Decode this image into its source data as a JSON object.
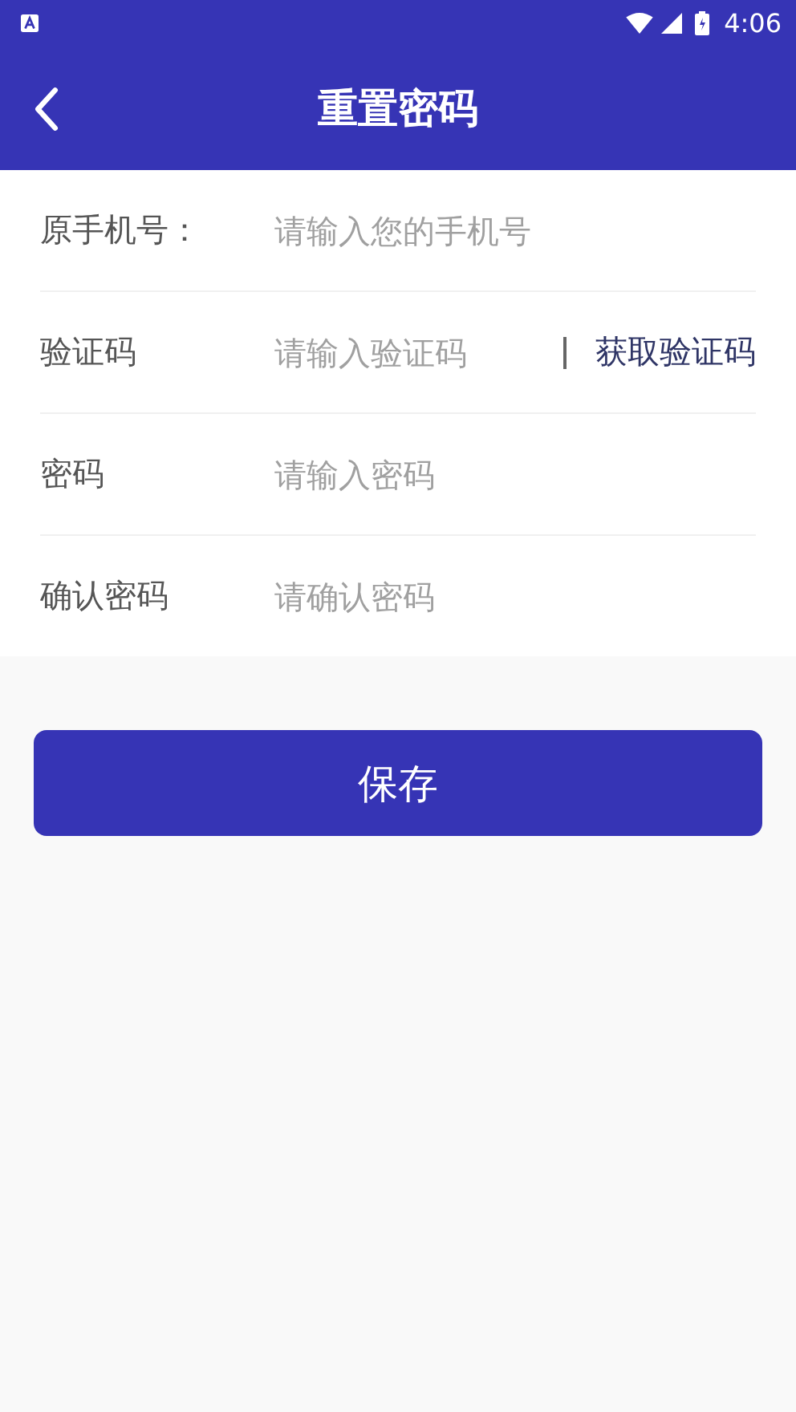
{
  "status_bar": {
    "time": "4:06"
  },
  "header": {
    "title": "重置密码"
  },
  "fields": [
    {
      "label": "原手机号：",
      "placeholder": "请输入您的手机号"
    },
    {
      "label": "验证码",
      "placeholder": "请输入验证码",
      "action": "获取验证码"
    },
    {
      "label": "密码",
      "placeholder": "请输入密码"
    },
    {
      "label": "确认密码",
      "placeholder": "请确认密码"
    }
  ],
  "save_button": "保存"
}
